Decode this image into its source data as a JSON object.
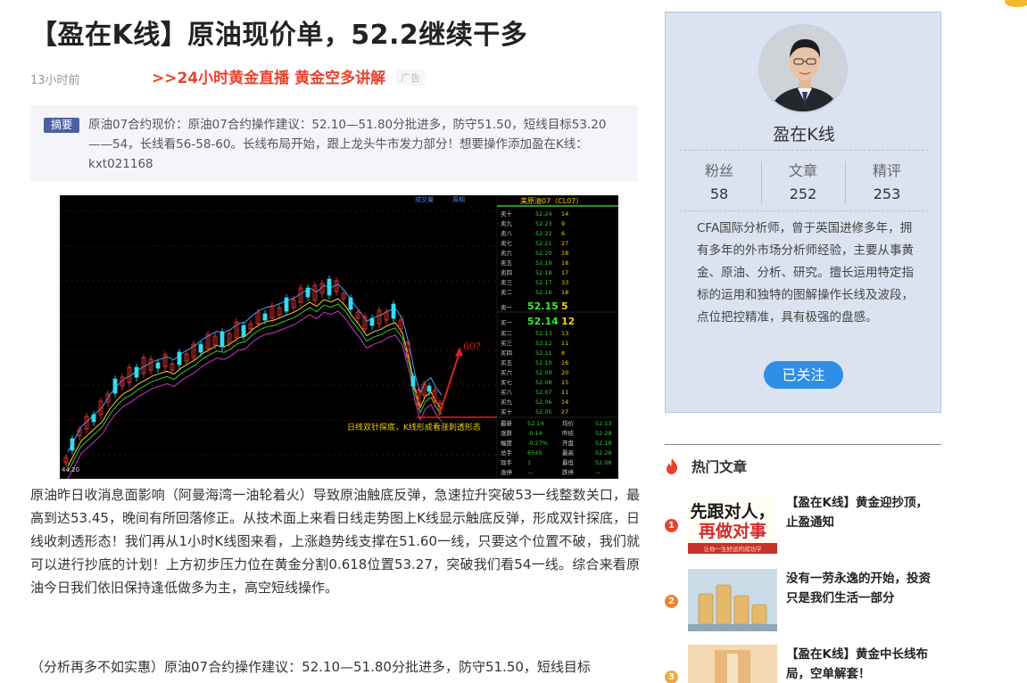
{
  "article": {
    "title": "【盈在K线】原油现价单，52.2继续干多",
    "time": "13小时前",
    "promo_link": ">>24小时黄金直播 黄金空多讲解",
    "ad_label": "广告",
    "summary_label": "摘要",
    "summary_text": "原油07合约现价：原油07合约操作建议：52.10—51.80分批进多，防守51.50，短线目标53.20——54，长线看56-58-60。长线布局开始，跟上龙头牛市发力部分！想要操作添加盈在K线：kxt021168",
    "paragraph1": "原油昨日收消息面影响（阿曼海湾一油轮着火）导致原油触底反弹，急速拉升突破53一线整数关口，最高到达53.45，晚间有所回落修正。从技术面上来看日线走势图上K线显示触底反弹，形成双针探底，日线收刺透形态！我们再从1小时K线图来看，上涨趋势线支撑在51.60一线，只要这个位置不破，我们就可以进行抄底的计划！上方初步压力位在黄金分割0.618位置53.27，突破我们看54一线。综合来看原油今日我们依旧保持逢低做多为主，高空短线操作。",
    "paragraph2": "（分析再多不如实惠）原油07合约操作建议：52.10—51.80分批进多，防守51.50，短线目标"
  },
  "chart_panel": {
    "header_left": [
      "成交量",
      "周期"
    ],
    "header_label": "美原油07（CL07）",
    "low_label": "44.20",
    "annotation": "日线双针探底，K线形成看涨刺透形态",
    "target_label": "60?",
    "asks": [
      {
        "label": "卖十",
        "price": "52.24",
        "vol": "14"
      },
      {
        "label": "卖九",
        "price": "52.23",
        "vol": "9"
      },
      {
        "label": "卖八",
        "price": "52.22",
        "vol": "6"
      },
      {
        "label": "卖七",
        "price": "52.21",
        "vol": "27"
      },
      {
        "label": "卖六",
        "price": "52.20",
        "vol": "18"
      },
      {
        "label": "卖五",
        "price": "52.19",
        "vol": "18"
      },
      {
        "label": "卖四",
        "price": "52.18",
        "vol": "17"
      },
      {
        "label": "卖三",
        "price": "52.17",
        "vol": "33"
      },
      {
        "label": "卖二",
        "price": "52.16",
        "vol": "18"
      }
    ],
    "ask1": {
      "label": "卖一",
      "price": "52.15",
      "vol": "5"
    },
    "bid1": {
      "label": "买一",
      "price": "52.14",
      "vol": "12"
    },
    "bids": [
      {
        "label": "买二",
        "price": "52.13",
        "vol": "13"
      },
      {
        "label": "买三",
        "price": "52.12",
        "vol": "11"
      },
      {
        "label": "买四",
        "price": "52.11",
        "vol": "8"
      },
      {
        "label": "买五",
        "price": "52.10",
        "vol": "16"
      },
      {
        "label": "买六",
        "price": "52.09",
        "vol": "20"
      },
      {
        "label": "买七",
        "price": "52.08",
        "vol": "15"
      },
      {
        "label": "买八",
        "price": "52.07",
        "vol": "11"
      },
      {
        "label": "买九",
        "price": "52.06",
        "vol": "14"
      },
      {
        "label": "买十",
        "price": "52.05",
        "vol": "27"
      }
    ],
    "quote": [
      {
        "k1": "最新",
        "v1": "52.14",
        "k2": "均价",
        "v2": "52.13"
      },
      {
        "k1": "涨跌",
        "v1": "-0.14",
        "k2": "昨结",
        "v2": "52.28"
      },
      {
        "k1": "幅度",
        "v1": "-0.27%",
        "k2": "开盘",
        "v2": "52.18"
      },
      {
        "k1": "总手",
        "v1": "6545",
        "k2": "最高",
        "v2": "52.26"
      },
      {
        "k1": "现手",
        "v1": "1",
        "k2": "最低",
        "v2": "52.06"
      },
      {
        "k1": "涨停",
        "v1": "—",
        "k2": "跌停",
        "v2": "—"
      }
    ]
  },
  "author": {
    "name": "盈在K线",
    "stats": [
      {
        "label": "粉丝",
        "value": "58"
      },
      {
        "label": "文章",
        "value": "252"
      },
      {
        "label": "精评",
        "value": "253"
      }
    ],
    "bio": "CFA国际分析师，曾于英国进修多年，拥有多年的外市场分析师经验，主要从事黄金、原油、分析、研究。擅长运用特定指标的运用和独特的图解操作长线及波段，点位把控精准，具有极强的盘感。",
    "follow_label": "已关注"
  },
  "hot": {
    "title": "热门文章",
    "items": [
      {
        "num": "1",
        "color": "#e8432e",
        "text": "【盈在K线】黄金迎抄顶，止盈通知",
        "thumb_big": "先跟对人，再做对事",
        "thumb_small": "让你一生好运的成功学"
      },
      {
        "num": "2",
        "color": "#f0812d",
        "text": "没有一劳永逸的开始，投资只是我们生活一部分",
        "thumb_big": "",
        "thumb_small": ""
      },
      {
        "num": "3",
        "color": "#f2a93b",
        "text": "【盈在K线】黄金中长线布局，空单解套！",
        "thumb_big": "",
        "thumb_small": ""
      }
    ]
  },
  "colors": {
    "accent_red": "#e8432e",
    "summary_tag": "#4c5fa3",
    "follow_blue": "#2f8ee5",
    "card_bg": "#dbe3f0"
  }
}
